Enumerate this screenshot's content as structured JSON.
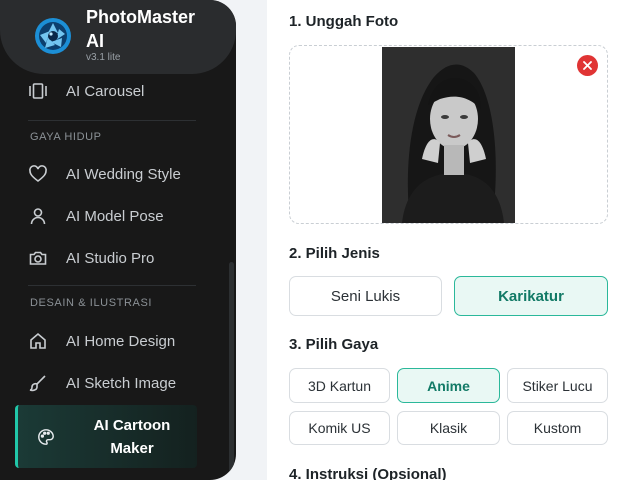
{
  "app": {
    "name_line1": "PhotoMaster",
    "name_line2": "AI",
    "version": "v3.1 lite"
  },
  "sidebar": {
    "top_items": [
      {
        "label": "AI Carousel",
        "icon": "carousel-icon"
      }
    ],
    "sections": [
      {
        "title": "GAYA HIDUP",
        "items": [
          {
            "label": "AI Wedding Style",
            "icon": "heart-icon"
          },
          {
            "label": "AI Model Pose",
            "icon": "user-icon"
          },
          {
            "label": "AI Studio Pro",
            "icon": "camera-icon"
          }
        ]
      },
      {
        "title": "DESAIN & ILUSTRASI",
        "items": [
          {
            "label": "AI Home Design",
            "icon": "home-icon"
          },
          {
            "label": "AI Sketch Image",
            "icon": "brush-icon"
          }
        ]
      }
    ],
    "active_item": {
      "line1": "AI Cartoon",
      "line2": "Maker",
      "icon": "palette-icon"
    }
  },
  "main": {
    "step1": {
      "title": "1. Unggah Foto"
    },
    "step2": {
      "title": "2. Pilih Jenis",
      "options": [
        "Seni Lukis",
        "Karikatur"
      ],
      "selected": "Karikatur"
    },
    "step3": {
      "title": "3. Pilih Gaya",
      "options": [
        "3D Kartun",
        "Anime",
        "Stiker Lucu",
        "Komik US",
        "Klasik",
        "Kustom"
      ],
      "selected": "Anime"
    },
    "step4": {
      "title": "4. Instruksi (Opsional)"
    }
  },
  "colors": {
    "accent": "#2bb89a",
    "sidebar_bg": "#181818",
    "remove": "#e03434"
  }
}
